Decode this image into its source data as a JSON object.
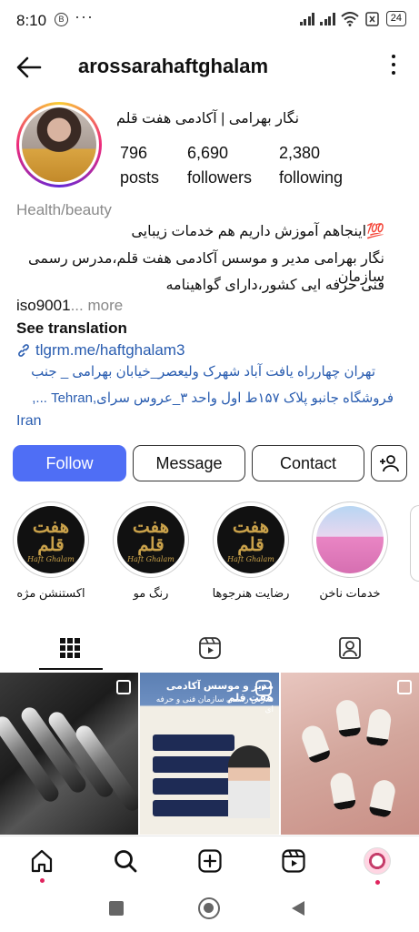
{
  "status": {
    "time": "8:10",
    "b_icon": "B",
    "dots": "···",
    "battery": "24"
  },
  "header": {
    "username": "arossarahaftghalam"
  },
  "profile": {
    "full_name": "نگار بهرامی | آکادمی هفت قلم",
    "posts": {
      "count": "796",
      "label": "posts"
    },
    "followers": {
      "count": "6,690",
      "label": "followers"
    },
    "following": {
      "count": "2,380",
      "label": "following"
    },
    "category": "Health/beauty",
    "bio_line1": "💯اینجاهم آموزش داریم هم خدمات زیبایی",
    "bio_line2": "نگار بهرامی مدیر و موسس آکادمی هفت قلم،مدرس رسمی سازمان",
    "bio_line3": "فنی حرفه ایی کشور،دارای گواهینامه",
    "bio_line4": "iso9001",
    "more": "... more",
    "see_translation": "See translation",
    "link": "tlgrm.me/haftghalam3",
    "address_line1": "تهران چهارراه یافت آباد شهرک ولیعصر_خیابان بهرامی _ جنب",
    "address_line2": "فروشگاه جانبو پلاک ۱۵۷ط اول واحد ۳_عروس سرای,Tehran ...,",
    "address_line3": "Iran"
  },
  "actions": {
    "follow": "Follow",
    "message": "Message",
    "contact": "Contact"
  },
  "highlights": [
    {
      "label": "اکستنشن مژه",
      "logo": "هفت قلم",
      "sub": "Haft Ghalam"
    },
    {
      "label": "رنگ مو",
      "logo": "هفت قلم",
      "sub": "Haft Ghalam"
    },
    {
      "label": "رضایت هنرجوها",
      "logo": "هفت قلم",
      "sub": "Haft Ghalam"
    },
    {
      "label": "خدمات ناخن"
    }
  ],
  "grid": {
    "post2_title": "مدیر و موسس آکادمی هفت قلم",
    "post2_subtitle": "مدرس رسمی سازمان فنی و حرفه ای"
  },
  "colors": {
    "follow_bg": "#4f6ef5",
    "link": "#2a5db0",
    "notif_dot": "#e0245e"
  },
  "icons": {
    "back": "arrow-left-icon",
    "menu": "kebab-icon",
    "add_user": "add-user-icon",
    "tab_grid": "grid-icon",
    "tab_reels": "reels-icon",
    "tab_tagged": "tagged-icon",
    "nav_home": "home-icon",
    "nav_search": "search-icon",
    "nav_create": "create-icon",
    "nav_reels": "reels-icon",
    "nav_profile": "profile-avatar"
  }
}
